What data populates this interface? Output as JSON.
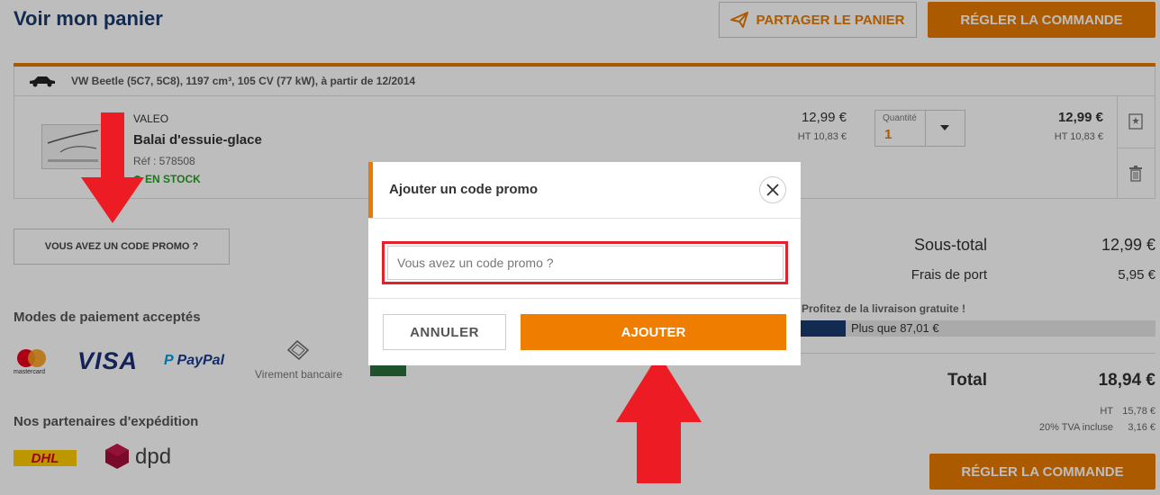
{
  "header": {
    "title": "Voir mon panier",
    "share_label": "PARTAGER LE PANIER",
    "checkout_label": "RÉGLER LA COMMANDE"
  },
  "cart": {
    "vehicle": "VW Beetle (5C7, 5C8), 1197 cm³, 105 CV (77 kW), à partir de 12/2014",
    "item": {
      "brand": "VALEO",
      "name": "Balai d'essuie-glace",
      "ref": "Réf : 578508",
      "stock": "EN STOCK",
      "price": "12,99 €",
      "price_ht": "HT 10,83 €",
      "qty_label": "Quantité",
      "qty_value": "1",
      "total": "12,99 €",
      "total_ht": "HT 10,83 €"
    }
  },
  "promo_link": "VOUS AVEZ UN CODE PROMO ?",
  "payment": {
    "heading": "Modes de paiement acceptés",
    "mastercard": "mastercard",
    "visa": "VISA",
    "paypal": "PayPal",
    "virement": "Virement bancaire"
  },
  "shipping": {
    "heading": "Nos partenaires d'expédition",
    "dhl": "DHL",
    "dpd": "dpd"
  },
  "summary": {
    "subtotal_label": "Sous-total",
    "subtotal_value": "12,99 €",
    "shipping_label": "Frais de port",
    "shipping_value": "5,95 €",
    "free_delivery_text": "Profitez de la livraison gratuite !",
    "free_delivery_progress": 0.13,
    "free_delivery_remaining": "Plus que 87,01 €",
    "total_label": "Total",
    "total_value": "18,94 €",
    "ht_label": "HT",
    "ht_value": "15,78 €",
    "tva_label": "20% TVA incluse",
    "tva_value": "3,16 €",
    "checkout_label": "RÉGLER LA COMMANDE"
  },
  "modal": {
    "title": "Ajouter un code promo",
    "input_placeholder": "Vous avez un code promo ?",
    "cancel_label": "ANNULER",
    "add_label": "AJOUTER"
  },
  "colors": {
    "accent": "#e97a00",
    "navy": "#1a3a6e",
    "stock_green": "#2a9d2a",
    "annotation_red": "#e4202d"
  }
}
